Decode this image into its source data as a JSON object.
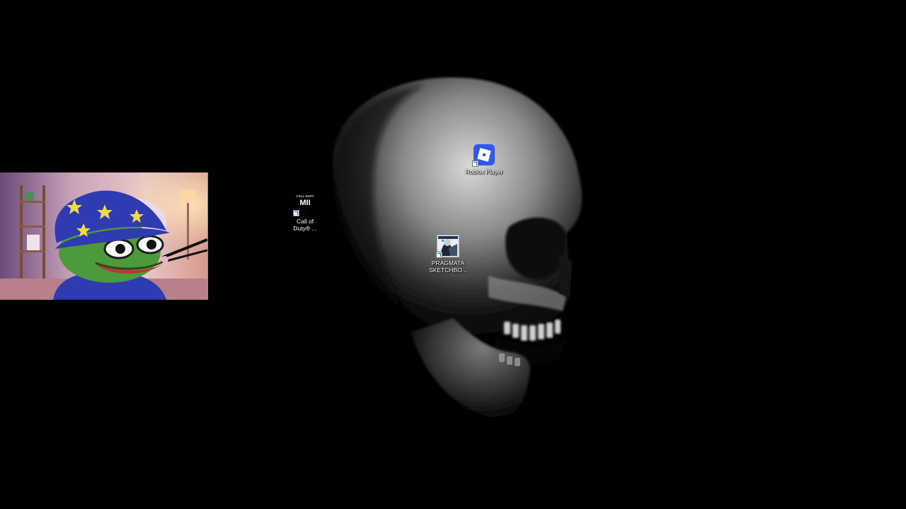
{
  "desktop": {
    "icons": [
      {
        "label": "Roblox Player",
        "icon": "roblox-icon"
      },
      {
        "label": "Call of\nDuty® ...",
        "icon": "call-of-duty-mw2-icon",
        "logo_text_top": "CALL DUTY",
        "logo_text_main": "MII"
      },
      {
        "label": "PRAGMATA\nSKETCHBO...",
        "icon": "pragmata-sketchbook-icon"
      }
    ]
  },
  "webcam": {
    "content": "peepo-wizard-avatar"
  },
  "colors": {
    "background": "#000000",
    "roblox_blue": "#3058ec",
    "webcam_border": "#b58a97"
  }
}
